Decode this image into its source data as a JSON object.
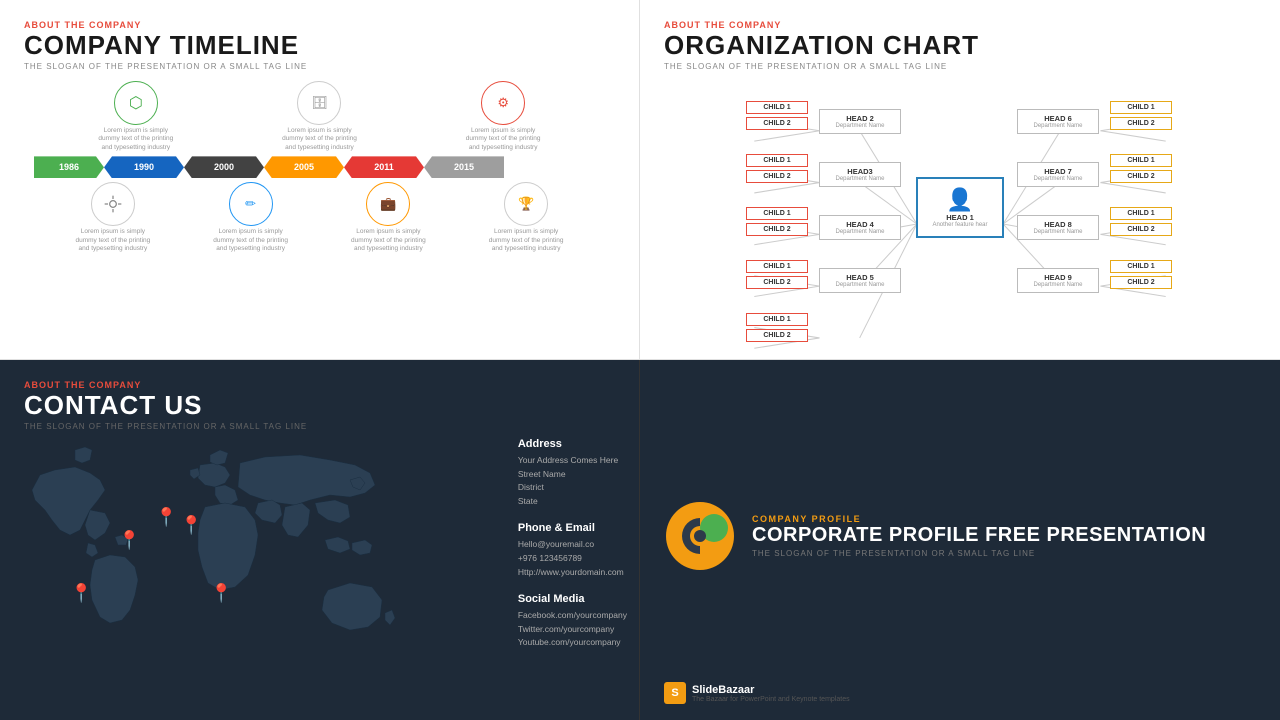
{
  "q1": {
    "about": "ABOUT THE COMPANY",
    "title": "COMPANY TIMELINE",
    "tagline": "THE SLOGAN OF THE PRESENTATION OR A SMALL TAG LINE",
    "years": [
      "1986",
      "1990",
      "2000",
      "2005",
      "2011",
      "2015"
    ],
    "lorem": "Lorem ipsum is simply dummy text of the printing and typesetting industry",
    "icons_top": [
      "⬡",
      "🗄",
      "⚙"
    ],
    "icons_bottom": [
      "✏",
      "💼",
      "🏆"
    ]
  },
  "q2": {
    "about": "ABOUT THE COMPANY",
    "title": "ORGANIZATION CHART",
    "tagline": "THE SLOGAN OF THE PRESENTATION OR A SMALL TAG LINE",
    "heads": [
      "HEAD 2",
      "HEAD3",
      "HEAD 4",
      "HEAD 5",
      "HEAD 6",
      "HEAD 7",
      "HEAD 8",
      "HEAD 9"
    ],
    "dept": "Department Name",
    "main_head": "HEAD 1",
    "main_sub": "Another feature hear",
    "child1": "CHILD 1",
    "child2": "CHILD 2"
  },
  "q3": {
    "about": "ABOUT THE COMPANY",
    "title": "CONTACT US",
    "tagline": "THE SLOGAN OF THE PRESENTATION OR A SMALL TAG LINE",
    "address_title": "Address",
    "address_lines": [
      "Your Address Comes Here",
      "Street Name",
      "District",
      "State"
    ],
    "phone_title": "Phone & Email",
    "phone_lines": [
      "Hello@youremail.co",
      "+976 123456789",
      "Http://www.yourdomain.com"
    ],
    "social_title": "Social Media",
    "social_lines": [
      "Facebook.com/yourcompany",
      "Twitter.com/yourcompany",
      "Youtube.com/yourcompany"
    ]
  },
  "q4": {
    "company_profile": "COMPANY PROFILE",
    "title": "CORPORATE PROFILE FREE PRESENTATION",
    "tagline": "THE SLOGAN OF THE PRESENTATION OR A SMALL TAG LINE",
    "brand": "SlideBazaar",
    "brand_sub": "The Bazaar for PowerPoint and Keynote templates"
  }
}
